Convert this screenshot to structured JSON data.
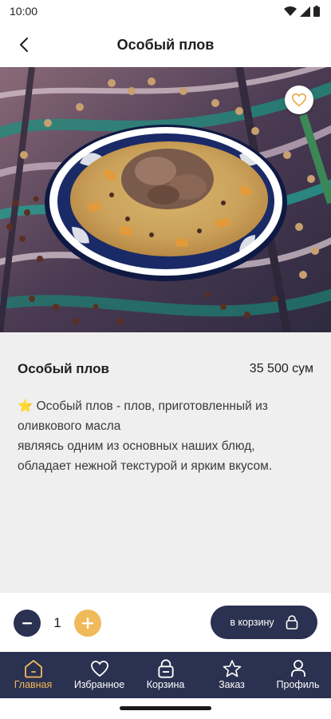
{
  "status_bar": {
    "time": "10:00"
  },
  "header": {
    "title": "Особый плов"
  },
  "product": {
    "name": "Особый плов",
    "price": "35 500 сум",
    "description_lines": [
      "⭐ Особый плов - плов, приготовленный из",
      "оливкового масла",
      "являясь одним из основных наших блюд,",
      "обладает нежной текстурой и ярким вкусом."
    ]
  },
  "quantity": {
    "value": "1"
  },
  "cart_button": {
    "label": "в корзину"
  },
  "nav": {
    "items": [
      {
        "label": "Главная",
        "icon": "home-icon",
        "active": true
      },
      {
        "label": "Избранное",
        "icon": "heart-icon",
        "active": false
      },
      {
        "label": "Корзина",
        "icon": "basket-icon",
        "active": false
      },
      {
        "label": "Заказ",
        "icon": "star-icon",
        "active": false
      },
      {
        "label": "Профиль",
        "icon": "user-icon",
        "active": false
      }
    ]
  },
  "colors": {
    "navy": "#2b3150",
    "gold": "#f0b95a",
    "background": "#efefef"
  }
}
